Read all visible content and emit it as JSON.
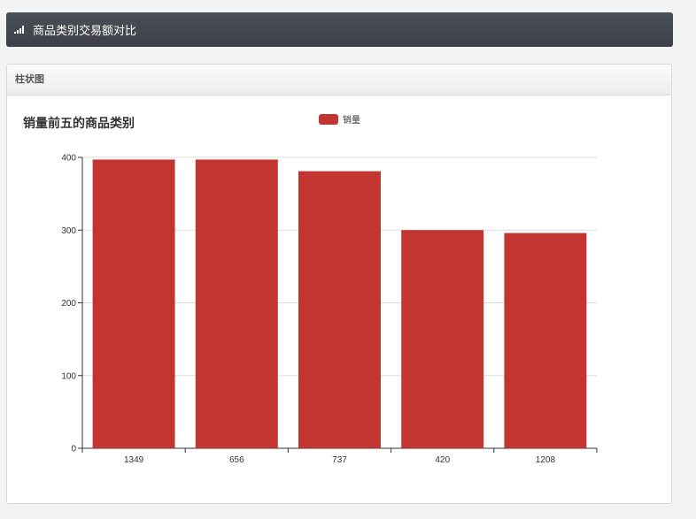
{
  "header": {
    "title": "商品类别交易额对比",
    "icon": "signal-icon"
  },
  "panel": {
    "heading": "柱状图"
  },
  "colors": {
    "bar": "#c23531",
    "grid": "#dddddd",
    "axis": "#333333"
  },
  "chart_data": {
    "type": "bar",
    "title": "销量前五的商品类别",
    "legend": [
      "销量"
    ],
    "legend_position": "top-center",
    "categories": [
      "1349",
      "656",
      "737",
      "420",
      "1208"
    ],
    "series": [
      {
        "name": "销量",
        "values": [
          397,
          397,
          381,
          300,
          296
        ]
      }
    ],
    "ylim": [
      0,
      400
    ],
    "yticks": [
      0,
      100,
      200,
      300,
      400
    ],
    "grid": true,
    "xlabel": "",
    "ylabel": ""
  }
}
